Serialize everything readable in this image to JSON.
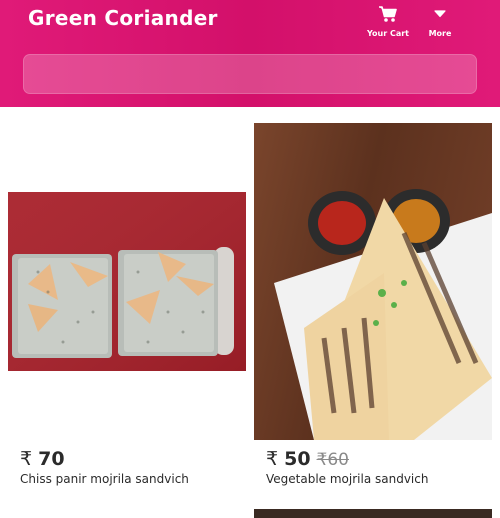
{
  "header": {
    "brand": "Green Coriander",
    "cart_label": "Your Cart",
    "more_label": "More",
    "search_placeholder": ""
  },
  "products": [
    {
      "name": "Chiss panir mojrila sandvich",
      "currency": "₹",
      "price": "70",
      "old_price": ""
    },
    {
      "name": "Vegetable mojrila sandvich",
      "currency": "₹",
      "price": "50",
      "old_price": "₹60"
    }
  ],
  "colors": {
    "header_bg": "#d3106a",
    "text": "#2b2b2b",
    "strike": "#8a8a8a"
  },
  "icons": {
    "cart": "cart-icon",
    "more": "chevron-down-icon"
  }
}
